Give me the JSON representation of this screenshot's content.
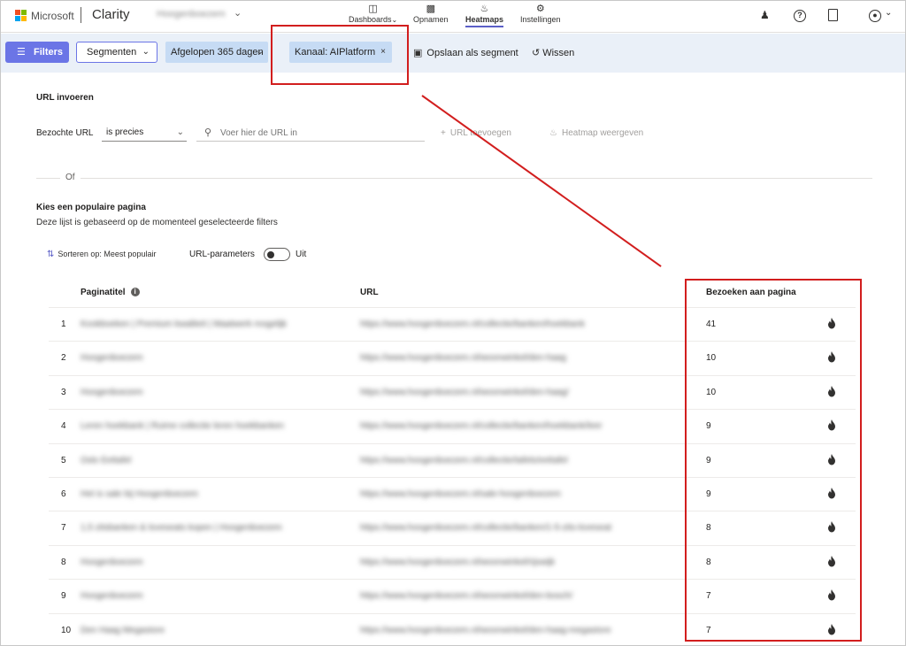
{
  "nav": {
    "brand": "Microsoft",
    "app": "Clarity",
    "project": "Hoogenboezem",
    "items": [
      {
        "label": "Dashboards",
        "icon": "dashboard-icon"
      },
      {
        "label": "Opnamen",
        "icon": "video-camera-icon"
      },
      {
        "label": "Heatmaps",
        "icon": "flame-icon",
        "active": true
      },
      {
        "label": "Instellingen",
        "icon": "gear-icon"
      }
    ],
    "tools": [
      "share-people-icon",
      "help-icon",
      "document-icon",
      "account-icon"
    ]
  },
  "filterbar": {
    "filters": "Filters",
    "segments": "Segmenten",
    "period": "Afgelopen 365 dagen",
    "channel": "Kanaal: AIPlatform",
    "save_segment": "Opslaan als segment",
    "clear": "Wissen"
  },
  "url_section": {
    "title": "URL invoeren",
    "field_label": "Bezochte URL",
    "operator": "is precies",
    "placeholder": "Voer hier de URL in",
    "add_url": "URL toevoegen",
    "show_heatmap": "Heatmap weergeven",
    "or": "Of"
  },
  "popular": {
    "title": "Kies een populaire pagina",
    "description": "Deze lijst is gebaseerd op de momenteel geselecteerde filters",
    "sort": "Sorteren op: Meest populair",
    "url_params": "URL-parameters",
    "url_params_state": "Uit"
  },
  "table": {
    "headers": {
      "title": "Paginatitel",
      "url": "URL",
      "visits": "Bezoeken aan pagina"
    },
    "rows": [
      {
        "rank": "1",
        "title": "Kookboeken | Premium kwaliteit | Maatwerk mogelijk",
        "url": "https://www.hoogenboezem.nl/collectie/banken/hoekbank",
        "visits": "41"
      },
      {
        "rank": "2",
        "title": "Hoogenboezem",
        "url": "https://www.hoogenboezem.nl/woonwinkel/den-haag",
        "visits": "10"
      },
      {
        "rank": "3",
        "title": "Hoogenboezem",
        "url": "https://www.hoogenboezem.nl/woonwinkel/den-haag/",
        "visits": "10"
      },
      {
        "rank": "4",
        "title": "Leren hoekbank | Ruime collectie leren hoekbanken",
        "url": "https://www.hoogenboezem.nl/collectie/banken/hoekbank/leer",
        "visits": "9"
      },
      {
        "rank": "5",
        "title": "Oslo Eettafel",
        "url": "https://www.hoogenboezem.nl/collectie/tafels/eettafel",
        "visits": "9"
      },
      {
        "rank": "6",
        "title": "Het is sale bij Hoogenboezem",
        "url": "https://www.hoogenboezem.nl/sale-hoogenboezem",
        "visits": "9"
      },
      {
        "rank": "7",
        "title": "1,5 zitsbanken & loveseats kopen | Hoogenboezem",
        "url": "https://www.hoogenboezem.nl/collectie/banken/1-5-zits-loveseat",
        "visits": "8"
      },
      {
        "rank": "8",
        "title": "Hoogenboezem",
        "url": "https://www.hoogenboezem.nl/woonwinkel/rijswijk",
        "visits": "8"
      },
      {
        "rank": "9",
        "title": "Hoogenboezem",
        "url": "https://www.hoogenboezem.nl/woonwinkel/den-bosch/",
        "visits": "7"
      },
      {
        "rank": "10",
        "title": "Den Haag Megastore",
        "url": "https://www.hoogenboezem.nl/woonwinkel/den-haag-megastore",
        "visits": "7"
      }
    ]
  },
  "colors": {
    "accent": "#6b75e6",
    "annotation": "#d21e1e",
    "filterbar_bg": "#eaf0f8"
  }
}
